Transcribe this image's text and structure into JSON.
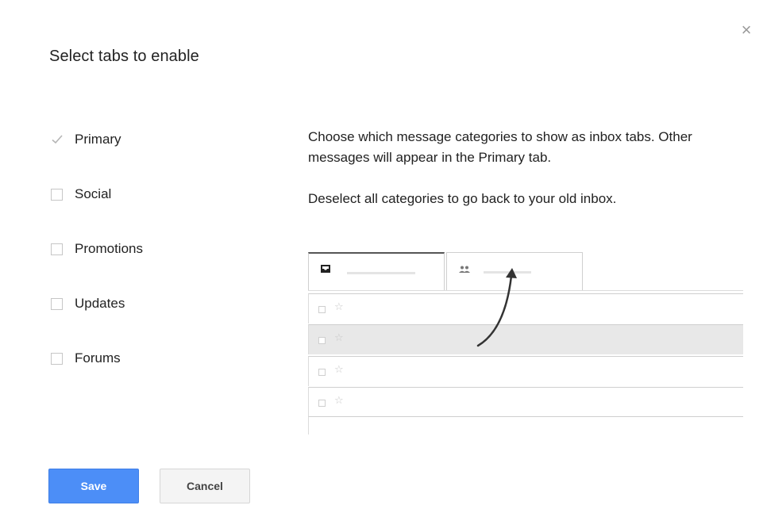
{
  "dialog": {
    "title": "Select tabs to enable",
    "close_icon": "close-icon"
  },
  "categories": [
    {
      "label": "Primary",
      "state": "checked-disabled"
    },
    {
      "label": "Social",
      "state": "unchecked"
    },
    {
      "label": "Promotions",
      "state": "unchecked"
    },
    {
      "label": "Updates",
      "state": "unchecked"
    },
    {
      "label": "Forums",
      "state": "unchecked"
    }
  ],
  "description": {
    "paragraph1": "Choose which message categories to show as inbox tabs. Other messages will appear in the Primary tab.",
    "paragraph2": "Deselect all categories to go back to your old inbox."
  },
  "preview": {
    "tab1_icon": "inbox-icon",
    "tab2_icon": "people-icon",
    "row_icons": [
      "checkbox-icon",
      "star-icon"
    ],
    "highlighted_row": 2,
    "star_glyph": "☆"
  },
  "buttons": {
    "save_label": "Save",
    "cancel_label": "Cancel"
  },
  "colors": {
    "save_button": "#4c8ef7",
    "cancel_button": "#f4f4f4",
    "highlight_row": "#e8e8e8"
  }
}
